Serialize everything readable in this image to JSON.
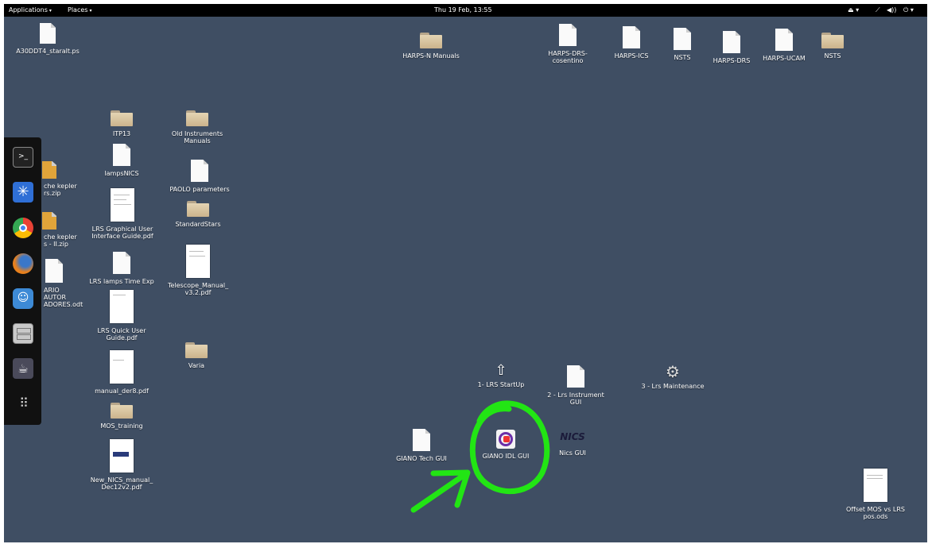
{
  "topbar": {
    "applications": "Applications",
    "places": "Places",
    "clock": "Thu 19 Feb, 13:55"
  },
  "desktop": {
    "a30": "A30DDT4_staralt.ps",
    "harpsn": "HARPS-N Manuals",
    "harpsdrs_cosentino": "HARPS-DRS-\ncosentino",
    "harpsics": "HARPS-ICS",
    "nsts1": "NSTS",
    "harpsdrs": "HARPS-DRS",
    "harpsucam": "HARPS-UCAM",
    "nsts2": "NSTS",
    "itp13": "ITP13",
    "old_instr": "Old Instruments\nManuals",
    "lampsnics": "lampsNICS",
    "kepler1": "che kepler\nrs.zip",
    "paolo": "PAOLO parameters",
    "kepler2": "che kepler\ns - II.zip",
    "lrs_gui_guide": "LRS Graphical User\nInterface Guide.pdf",
    "standardstars": "StandardStars",
    "usuario": "ARIO AUTOR\nADORES.odt",
    "lrs_lamps": "LRS lamps Time Exp",
    "telescope": "Telescope_Manual_\nv3.2.pdf",
    "lrs_quick": "LRS Quick User\nGuide.pdf",
    "varia": "Varia",
    "manual_der8": "manual_der8.pdf",
    "mos_training": "MOS_training",
    "new_nics": "New_NICS_manual_\nDec12v2.pdf",
    "lrs_startup": "1- LRS StartUp",
    "lrs_instr": "2 - Lrs Instrument\nGUI",
    "lrs_maint": "3 - Lrs Maintenance",
    "giano_tech": "GIANO Tech GUI",
    "giano_idl": "GIANO IDL GUI",
    "nics_gui": "Nics GUI",
    "nics_logo_text": "NICS",
    "offset_mos": "Offset MOS vs LRS\npos.ods"
  },
  "dock": [
    "terminal-icon",
    "safari-compass-icon",
    "chrome-icon",
    "firefox-icon",
    "chat-icon",
    "file-cabinet-icon",
    "java-icon",
    "app-grid-icon"
  ],
  "colors": {
    "desktop_bg": "#3f4e63",
    "annotation": "#22e514"
  }
}
